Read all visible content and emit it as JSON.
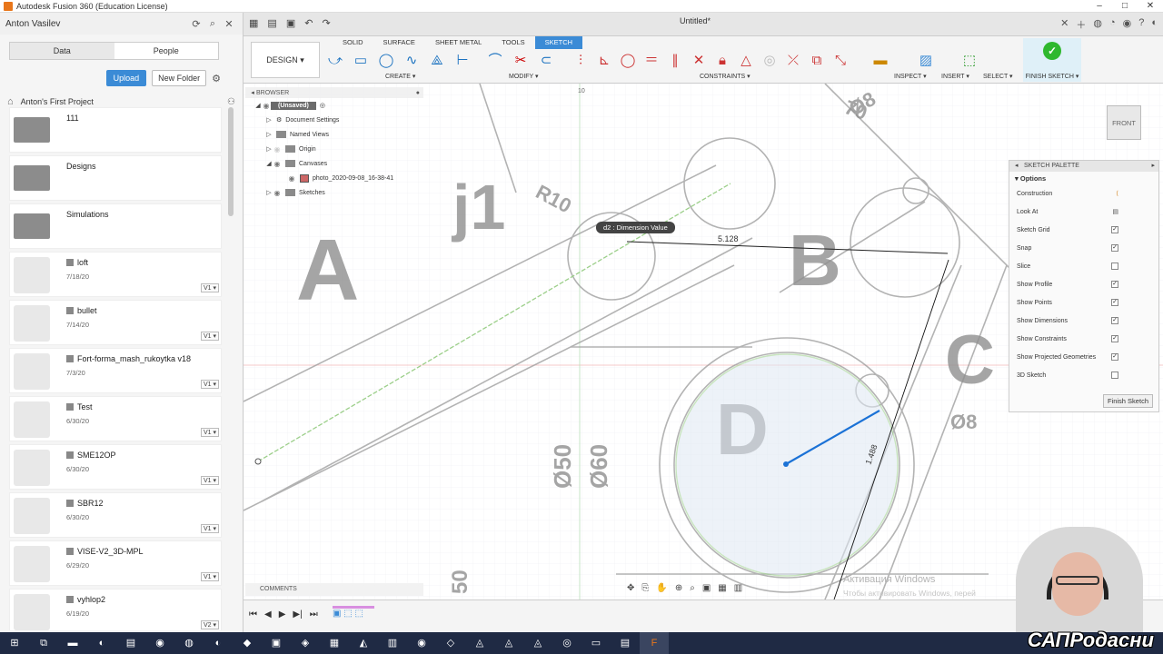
{
  "window": {
    "title": "Autodesk Fusion 360 (Education License)"
  },
  "datapanel": {
    "user": "Anton Vasilev",
    "tabs": [
      "Data",
      "People"
    ],
    "upload": "Upload",
    "new_folder": "New Folder",
    "project": "Anton's First Project",
    "items": [
      {
        "name": "111",
        "date": "",
        "ver": "",
        "type": "folder"
      },
      {
        "name": "Designs",
        "date": "",
        "ver": "",
        "type": "folder"
      },
      {
        "name": "Simulations",
        "date": "",
        "ver": "",
        "type": "folder"
      },
      {
        "name": "loft",
        "date": "7/18/20",
        "ver": "V1 ▾",
        "type": "design"
      },
      {
        "name": "bullet",
        "date": "7/14/20",
        "ver": "V1 ▾",
        "type": "design"
      },
      {
        "name": "Fort-forma_mash_rukoytka v18",
        "date": "7/3/20",
        "ver": "V1 ▾",
        "type": "design"
      },
      {
        "name": "Test",
        "date": "6/30/20",
        "ver": "V1 ▾",
        "type": "design"
      },
      {
        "name": "SME12OP",
        "date": "6/30/20",
        "ver": "V1 ▾",
        "type": "design"
      },
      {
        "name": "SBR12",
        "date": "6/30/20",
        "ver": "V1 ▾",
        "type": "design"
      },
      {
        "name": "VISE-V2_3D-MPL",
        "date": "6/29/20",
        "ver": "V1 ▾",
        "type": "design"
      },
      {
        "name": "vyhlop2",
        "date": "6/19/20",
        "ver": "V2 ▾",
        "type": "design"
      }
    ]
  },
  "doc_tab": "Untitled*",
  "toolbar": {
    "design": "DESIGN ▾",
    "tabs": [
      "SOLID",
      "SURFACE",
      "SHEET METAL",
      "TOOLS",
      "SKETCH"
    ],
    "groups": [
      "CREATE ▾",
      "MODIFY ▾",
      "CONSTRAINTS ▾",
      "INSPECT ▾",
      "INSERT ▾",
      "SELECT ▾"
    ],
    "finish": "FINISH SKETCH ▾"
  },
  "browser": {
    "title": "BROWSER",
    "rows": [
      "(Unsaved)",
      "Document Settings",
      "Named Views",
      "Origin",
      "Canvases",
      "photo_2020-09-08_16-38-41",
      "Sketches"
    ]
  },
  "canvas": {
    "dim_tip": "d2 : Dimension Value",
    "dim_value": "5.128",
    "viewcube": "FRONT"
  },
  "palette": {
    "title": "SKETCH PALETTE",
    "section": "Options",
    "rows": [
      {
        "label": "Construction",
        "checked": null
      },
      {
        "label": "Look At",
        "checked": null
      },
      {
        "label": "Sketch Grid",
        "checked": true
      },
      {
        "label": "Snap",
        "checked": true
      },
      {
        "label": "Slice",
        "checked": false
      },
      {
        "label": "Show Profile",
        "checked": true
      },
      {
        "label": "Show Points",
        "checked": true
      },
      {
        "label": "Show Dimensions",
        "checked": true
      },
      {
        "label": "Show Constraints",
        "checked": true
      },
      {
        "label": "Show Projected Geometries",
        "checked": true
      },
      {
        "label": "3D Sketch",
        "checked": false
      }
    ],
    "finish": "Finish Sketch"
  },
  "comments": "COMMENTS",
  "watermark": {
    "line1": "Активация Windows",
    "line2": "Чтобы активировать Windows, перей"
  },
  "brand": "САПРодасни"
}
